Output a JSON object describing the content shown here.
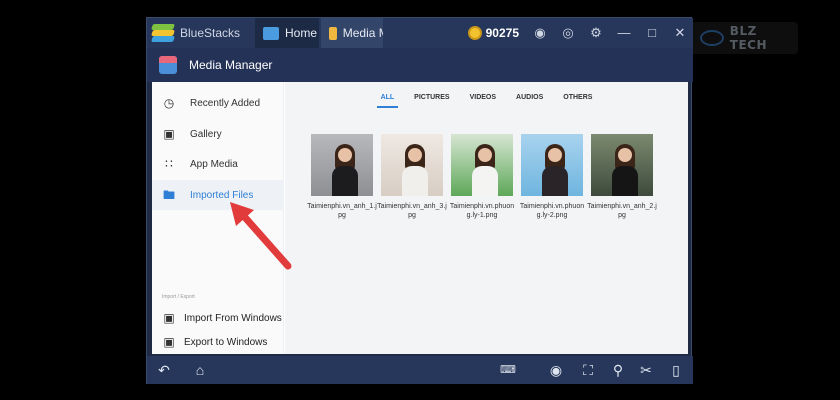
{
  "watermark": {
    "text": "BLZ TECH"
  },
  "titlebar": {
    "brand": "BlueStacks",
    "tabs": [
      {
        "label": "Home",
        "icon": "home-tab-icon",
        "color": "#4a9be0"
      },
      {
        "label": "Media Manager",
        "icon": "folder-tab-icon",
        "color": "#f0b740"
      }
    ],
    "coins": "90275",
    "icons": [
      "bell-icon",
      "account-icon",
      "gear-icon",
      "minimize-icon",
      "maximize-icon",
      "close-icon"
    ]
  },
  "app": {
    "title": "Media Manager"
  },
  "sidebar": {
    "items": [
      {
        "label": "Recently Added",
        "icon": "clock-icon",
        "active": false
      },
      {
        "label": "Gallery",
        "icon": "gallery-icon",
        "active": false
      },
      {
        "label": "App Media",
        "icon": "grid-icon",
        "active": false
      },
      {
        "label": "Imported Files",
        "icon": "folder-icon",
        "active": true
      }
    ],
    "section_caption": "Import / Export",
    "actions": [
      {
        "label": "Import From Windows",
        "icon": "import-icon"
      },
      {
        "label": "Export to Windows",
        "icon": "export-icon"
      }
    ]
  },
  "filters": {
    "items": [
      "ALL",
      "PICTURES",
      "VIDEOS",
      "AUDIOS",
      "OTHERS"
    ],
    "active": "ALL"
  },
  "files": [
    {
      "name": "Taimienphi.vn_anh_1.jpg",
      "bg": "#8d8f93",
      "top": "#b7b9bd",
      "body": "#1c1c1f"
    },
    {
      "name": "Taimienphi.vn_anh_3.jpg",
      "bg": "#d7cdc3",
      "top": "#efe9e3",
      "body": "#f1efec"
    },
    {
      "name": "Taimienphi.vn.phuong.ly-1.png",
      "bg": "#5ea85a",
      "top": "#d7e6d2",
      "body": "#f4f4f2"
    },
    {
      "name": "Taimienphi.vn.phuong.ly-2.png",
      "bg": "#6fb5df",
      "top": "#a8d3ee",
      "body": "#2a2428"
    },
    {
      "name": "Taimienphi.vn_anh_2.jpg",
      "bg": "#3e4a3c",
      "top": "#7c8a70",
      "body": "#151516"
    }
  ],
  "bottombar": {
    "icons": [
      "back-icon",
      "home-icon",
      "keyboard-icon",
      "eye-icon",
      "resize-icon",
      "location-icon",
      "scissors-icon",
      "rotate-icon"
    ]
  },
  "colors": {
    "accent": "#2f7fd6",
    "arrow": "#e23b3b",
    "titlebar": "#27375b"
  }
}
